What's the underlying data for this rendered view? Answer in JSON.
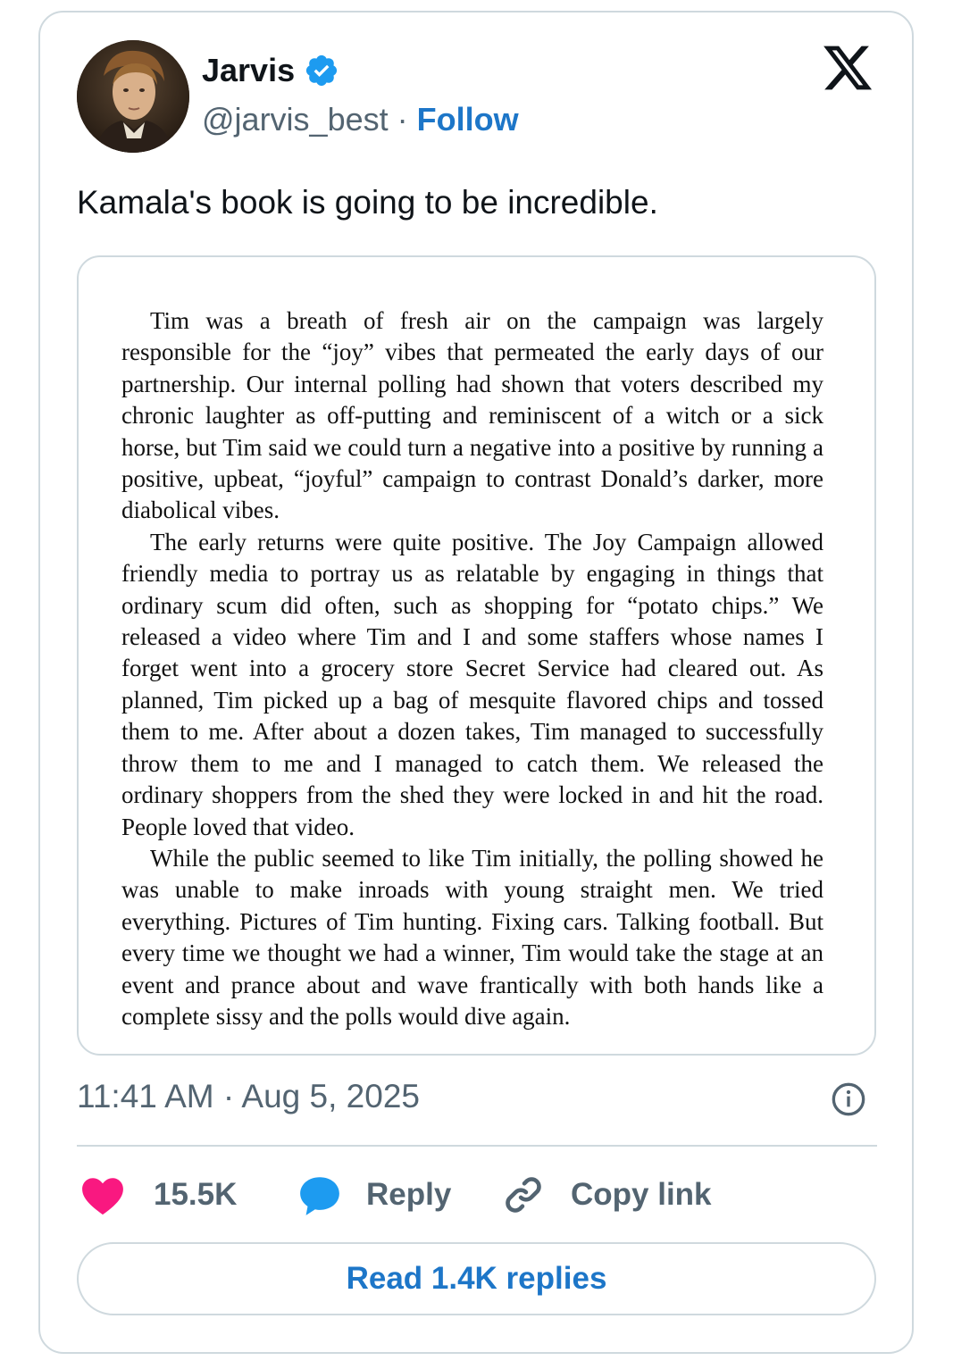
{
  "author": {
    "display_name": "Jarvis",
    "handle": "@jarvis_best",
    "separator": "·",
    "follow_label": "Follow"
  },
  "tweet": {
    "text": "Kamala's book is going to be incredible."
  },
  "book_page": {
    "paragraphs": [
      "Tim was a breath of fresh air on the campaign was largely responsible for the “joy” vibes that permeated the early days of our partnership. Our internal polling had shown that voters described my chronic laughter as off-putting and reminiscent of a witch or a sick horse, but Tim said we could turn a negative into a positive by running a positive, upbeat, “joyful” campaign to contrast Donald’s darker, more diabolical vibes.",
      "The early returns were quite positive. The Joy Campaign allowed friendly media to portray us as relatable by engaging in things that ordinary scum did often, such as shopping for “potato chips.” We released a video where Tim and I and some staffers whose names I forget went into a grocery store Secret Service had cleared out. As planned, Tim picked up a bag of mesquite flavored chips and tossed them to me. After about a dozen takes, Tim managed to successfully throw them to me and I managed to catch them. We released the ordinary shoppers from the shed they were locked in and hit the road. People loved that video.",
      "While the public seemed to like Tim initially, the polling showed he was unable to make inroads with young straight men. We tried everything. Pictures of Tim hunting. Fixing cars. Talking football. But every time we thought we had a winner, Tim would take the stage at an event and prance about and wave frantically with both hands like a complete sissy and the polls would dive again."
    ]
  },
  "meta": {
    "timestamp": "11:41 AM · Aug 5, 2025"
  },
  "actions": {
    "likes": "15.5K",
    "reply_label": "Reply",
    "copy_label": "Copy link"
  },
  "read_replies_label": "Read 1.4K replies",
  "colors": {
    "accent": "#1d76c8",
    "like": "#f91880",
    "reply_icon": "#1d9bf0",
    "muted": "#536471",
    "border": "#cfd9de"
  },
  "icons": [
    "verified-badge-icon",
    "x-logo-icon",
    "info-icon",
    "heart-icon",
    "reply-bubble-icon",
    "link-icon"
  ]
}
